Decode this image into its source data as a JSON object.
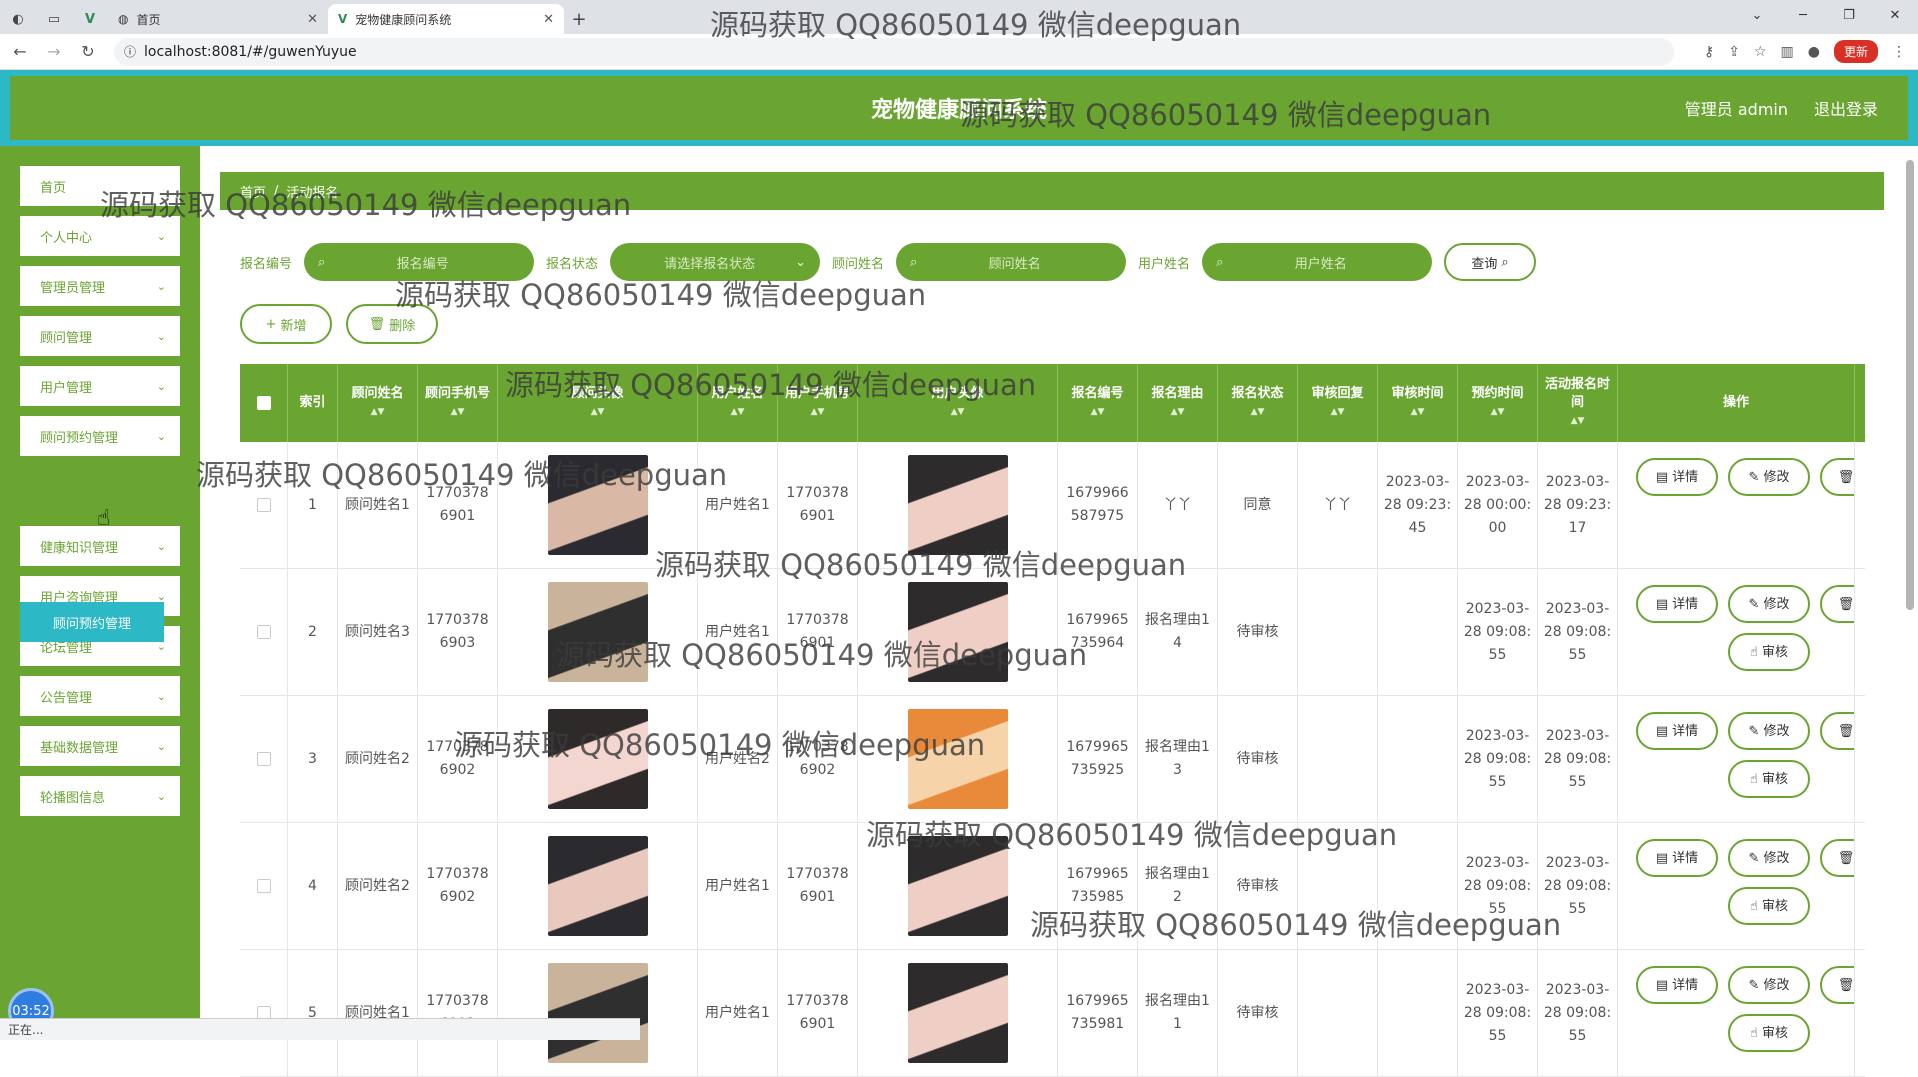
{
  "browser": {
    "tabs": [
      {
        "label": "首页"
      },
      {
        "label": "宠物健康顾问系统"
      }
    ],
    "url": "localhost:8081/#/guwenYuyue",
    "update_label": "更新"
  },
  "header": {
    "title": "宠物健康顾问系统",
    "user": "管理员 admin",
    "logout": "退出登录"
  },
  "sidebar": {
    "items": [
      {
        "label": "首页",
        "has_chevron": false
      },
      {
        "label": "个人中心",
        "has_chevron": true
      },
      {
        "label": "管理员管理",
        "has_chevron": true
      },
      {
        "label": "顾问管理",
        "has_chevron": true
      },
      {
        "label": "用户管理",
        "has_chevron": true
      },
      {
        "label": "顾问预约管理",
        "has_chevron": true
      },
      {
        "label": "健康知识管理",
        "has_chevron": true
      },
      {
        "label": "用户咨询管理",
        "has_chevron": true
      },
      {
        "label": "论坛管理",
        "has_chevron": true
      },
      {
        "label": "公告管理",
        "has_chevron": true
      },
      {
        "label": "基础数据管理",
        "has_chevron": true
      },
      {
        "label": "轮播图信息",
        "has_chevron": true
      }
    ],
    "active_sub": "顾问预约管理"
  },
  "breadcrumb": {
    "home": "首页",
    "separator": "/",
    "current": "活动报名"
  },
  "search": {
    "fields": [
      {
        "label": "报名编号",
        "placeholder": "报名编号",
        "type": "input"
      },
      {
        "label": "报名状态",
        "placeholder": "请选择报名状态",
        "type": "select"
      },
      {
        "label": "顾问姓名",
        "placeholder": "顾问姓名",
        "type": "input"
      },
      {
        "label": "用户姓名",
        "placeholder": "用户姓名",
        "type": "input"
      }
    ],
    "query_label": "查询"
  },
  "actions": {
    "add_label": "新增",
    "delete_label": "删除"
  },
  "table": {
    "columns": [
      "索引",
      "顾问姓名",
      "顾问手机号",
      "顾问头像",
      "用户姓名",
      "用户手机号",
      "用户头像",
      "报名编号",
      "报名理由",
      "报名状态",
      "审核回复",
      "审核时间",
      "预约时间",
      "活动报名时间",
      "操作"
    ],
    "rows": [
      {
        "idx": "1",
        "gname": "顾问姓名1",
        "gphone": "17703786901",
        "uname": "用户姓名1",
        "uphone": "17703786901",
        "no": "1679966587975",
        "reason": "丫丫",
        "status": "同意",
        "reply": "丫丫",
        "audit_time": "2023-03-28 09:23:45",
        "book_time": "2023-03-28 00:00:00",
        "apply_time": "2023-03-28 09:23:17",
        "can_audit": false
      },
      {
        "idx": "2",
        "gname": "顾问姓名3",
        "gphone": "17703786903",
        "uname": "用户姓名1",
        "uphone": "17703786901",
        "no": "1679965735964",
        "reason": "报名理由14",
        "status": "待审核",
        "reply": "",
        "audit_time": "",
        "book_time": "2023-03-28 09:08:55",
        "apply_time": "2023-03-28 09:08:55",
        "can_audit": true
      },
      {
        "idx": "3",
        "gname": "顾问姓名2",
        "gphone": "17703786902",
        "uname": "用户姓名2",
        "uphone": "17703786902",
        "no": "1679965735925",
        "reason": "报名理由13",
        "status": "待审核",
        "reply": "",
        "audit_time": "",
        "book_time": "2023-03-28 09:08:55",
        "apply_time": "2023-03-28 09:08:55",
        "can_audit": true
      },
      {
        "idx": "4",
        "gname": "顾问姓名2",
        "gphone": "17703786902",
        "uname": "用户姓名1",
        "uphone": "17703786901",
        "no": "1679965735985",
        "reason": "报名理由12",
        "status": "待审核",
        "reply": "",
        "audit_time": "",
        "book_time": "2023-03-28 09:08:55",
        "apply_time": "2023-03-28 09:08:55",
        "can_audit": true
      },
      {
        "idx": "5",
        "gname": "顾问姓名1",
        "gphone": "17703786901",
        "uname": "用户姓名1",
        "uphone": "17703786901",
        "no": "1679965735981",
        "reason": "报名理由11",
        "status": "待审核",
        "reply": "",
        "audit_time": "",
        "book_time": "2023-03-28 09:08:55",
        "apply_time": "2023-03-28 09:08:55",
        "can_audit": true
      }
    ],
    "op_labels": {
      "detail": "详情",
      "edit": "修改",
      "delete": "删除",
      "audit": "审核"
    }
  },
  "watermark": "源码获取 QQ86050149 微信deepguan",
  "timer": "03:52",
  "statusbar": "正在...",
  "colors": {
    "primary": "#6aa532",
    "accent": "#2cb8c4"
  }
}
